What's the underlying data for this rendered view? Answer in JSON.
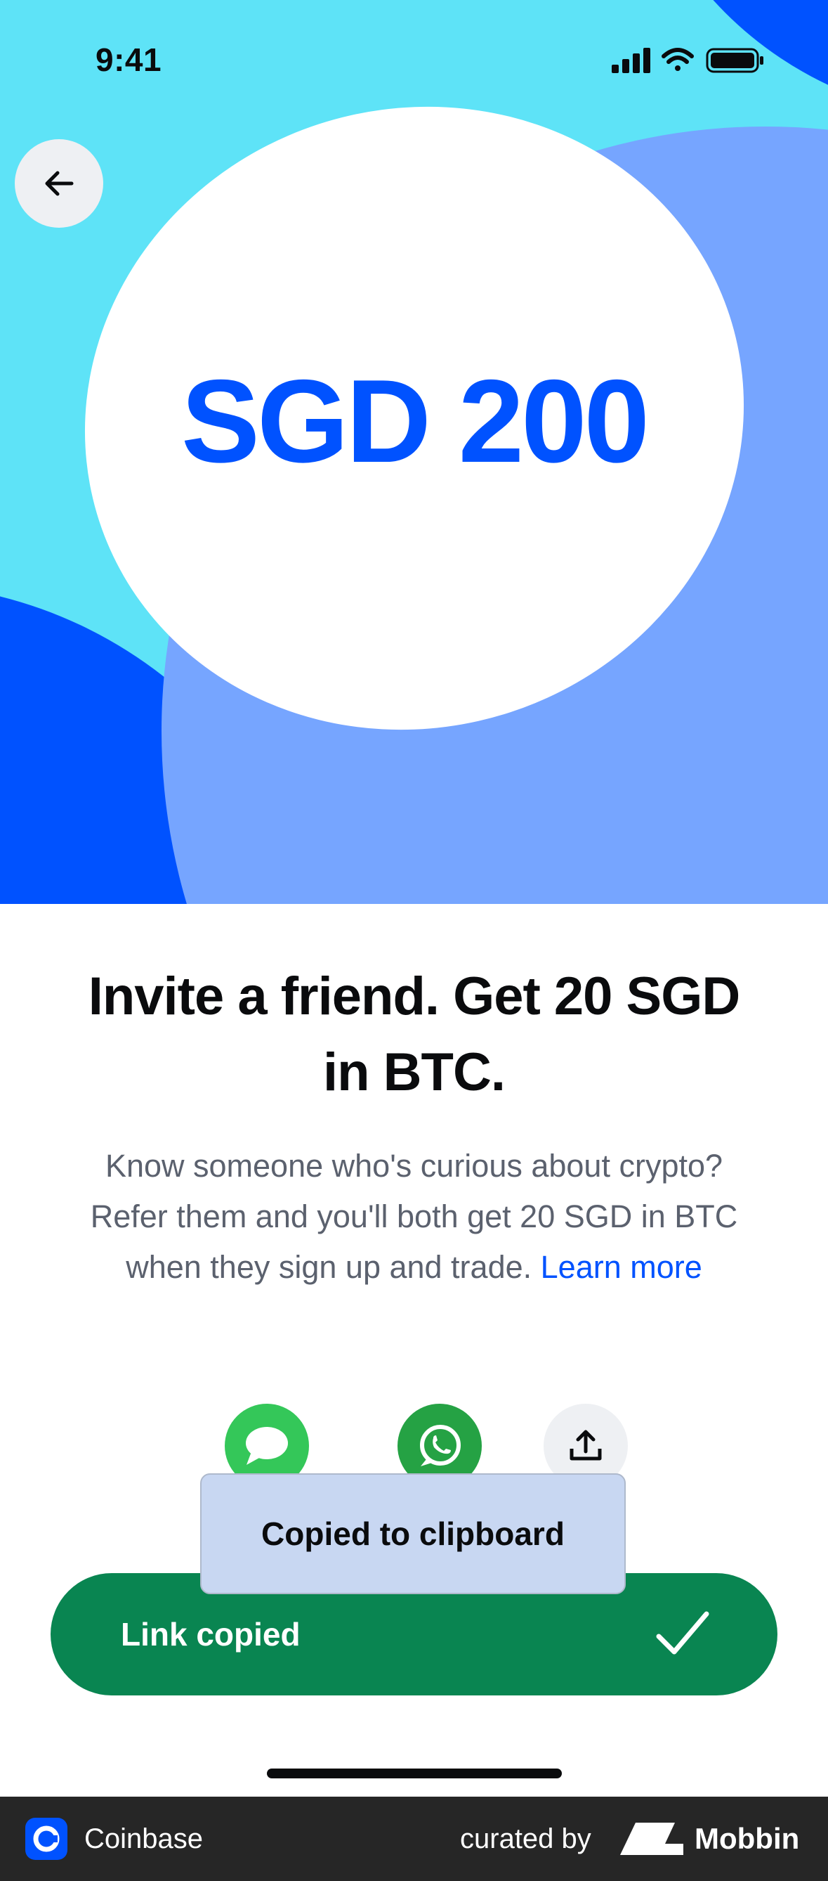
{
  "status_bar": {
    "time": "9:41"
  },
  "hero": {
    "amount": "SGD 200",
    "colors": {
      "cyan": "#5ee3f7",
      "blue": "#0052ff",
      "light_blue": "#76a5ff",
      "white": "#ffffff"
    }
  },
  "nav": {
    "back_icon": "arrow-left-icon"
  },
  "content": {
    "headline_line1": "Invite a friend. Get 20 SGD",
    "headline_line2": "in BTC.",
    "desc_line1": "Know someone who's curious about crypto?",
    "desc_line2": "Refer them and you'll both get 20 SGD in BTC",
    "desc_line3": "when they sign up and trade.",
    "learn_more": "Learn more"
  },
  "share": {
    "icons": [
      "messages-icon",
      "whatsapp-icon",
      "share-icon"
    ]
  },
  "toast": {
    "text": "Copied to clipboard"
  },
  "cta": {
    "label": "Link copied",
    "icon": "checkmark-icon",
    "color": "#098551"
  },
  "footer": {
    "app_name": "Coinbase",
    "curated_by": "curated by",
    "brand": "Mobbin"
  }
}
